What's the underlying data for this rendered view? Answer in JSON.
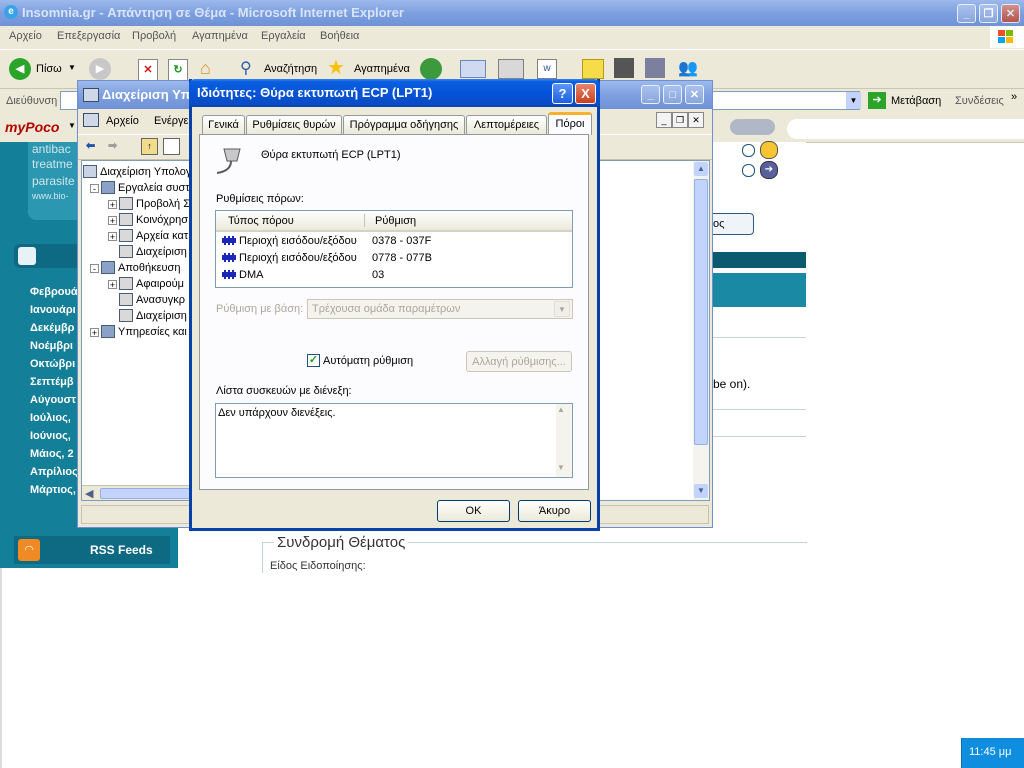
{
  "ie": {
    "title": "Insomnia.gr - Απάντηση σε Θέμα - Microsoft Internet Explorer",
    "menu": [
      "Αρχείο",
      "Επεξεργασία",
      "Προβολή",
      "Αγαπημένα",
      "Εργαλεία",
      "Βοήθεια"
    ],
    "toolbar": {
      "back": "Πίσω",
      "search": "Αναζήτηση",
      "favorites": "Αγαπημένα"
    },
    "address_label": "Διεύθυνση",
    "go": "Μετάβαση",
    "links": "Συνδέσεις",
    "brand": "myPoco"
  },
  "page": {
    "sidebar_texts": [
      "antibac",
      "treatme",
      "parasite",
      "www.bio-"
    ],
    "months": [
      "Φεβρουά",
      "Ιανουάρι",
      "Δεκέμβρ",
      "Νοέμβρι",
      "Οκτώβρι",
      "Σεπτέμβ",
      "Αύγουστ",
      "Ιούλιος,",
      "Ιούνιος,",
      "Μάιος, 2",
      "Απρίλιος",
      "Μάρτιος,"
    ],
    "rss": "RSS Feeds",
    "subscribe_heading": "Συνδρομή Θέματος",
    "subscribe_sub": "Είδος Ειδοποίησης:",
    "snippet_be_on": "be on).",
    "snippet_os": "ος"
  },
  "mmc": {
    "title": "Διαχείριση Υπ",
    "menu": [
      "Αρχείο",
      "Ενέργει"
    ],
    "tree": [
      {
        "label": "Διαχείριση Υπολογ",
        "level": 0,
        "expander": ""
      },
      {
        "label": "Εργαλεία συστ",
        "level": 1,
        "expander": "-"
      },
      {
        "label": "Προβολή Σ",
        "level": 2,
        "expander": "+"
      },
      {
        "label": "Κοινόχρησ",
        "level": 2,
        "expander": "+"
      },
      {
        "label": "Αρχεία κατ",
        "level": 2,
        "expander": "+"
      },
      {
        "label": "Διαχείριση",
        "level": 2,
        "expander": ""
      },
      {
        "label": "Αποθήκευση",
        "level": 1,
        "expander": "-"
      },
      {
        "label": "Αφαιρούμ",
        "level": 2,
        "expander": "+"
      },
      {
        "label": "Ανασυγκρ",
        "level": 2,
        "expander": ""
      },
      {
        "label": "Διαχείριση",
        "level": 2,
        "expander": ""
      },
      {
        "label": "Υπηρεσίες και",
        "level": 1,
        "expander": "+"
      }
    ]
  },
  "dialog": {
    "title": "Ιδιότητες: Θύρα εκτυπωτή ECP (LPT1)",
    "tabs": [
      "Γενικά",
      "Ρυθμίσεις θυρών",
      "Πρόγραμμα οδήγησης",
      "Λεπτομέρειες",
      "Πόροι"
    ],
    "selected_tab": 4,
    "device_name": "Θύρα εκτυπωτή ECP (LPT1)",
    "resource_settings_label": "Ρυθμίσεις πόρων:",
    "columns": [
      "Τύπος πόρου",
      "Ρύθμιση"
    ],
    "resources": [
      {
        "type": "Περιοχή εισόδου/εξόδου",
        "setting": "0378 - 037F"
      },
      {
        "type": "Περιοχή εισόδου/εξόδου",
        "setting": "0778 - 077B"
      },
      {
        "type": "DMA",
        "setting": "03"
      }
    ],
    "based_on_label": "Ρύθμιση με βάση:",
    "based_on_value": "Τρέχουσα ομάδα παραμέτρων",
    "auto_label": "Αυτόματη ρύθμιση",
    "auto_checked": true,
    "change_button": "Αλλαγή ρύθμισης...",
    "conflict_label": "Λίστα συσκευών με διένεξη:",
    "conflict_text": "Δεν υπάρχουν διενέξεις.",
    "ok": "OK",
    "cancel": "Άκυρο",
    "help": "?",
    "close": "X"
  },
  "taskbar": {
    "clock": "11:45 μμ"
  },
  "colors": {
    "accent": "#0a5fe0",
    "page_teal": "#137f98",
    "dialog_bg": "#ece9d8"
  }
}
